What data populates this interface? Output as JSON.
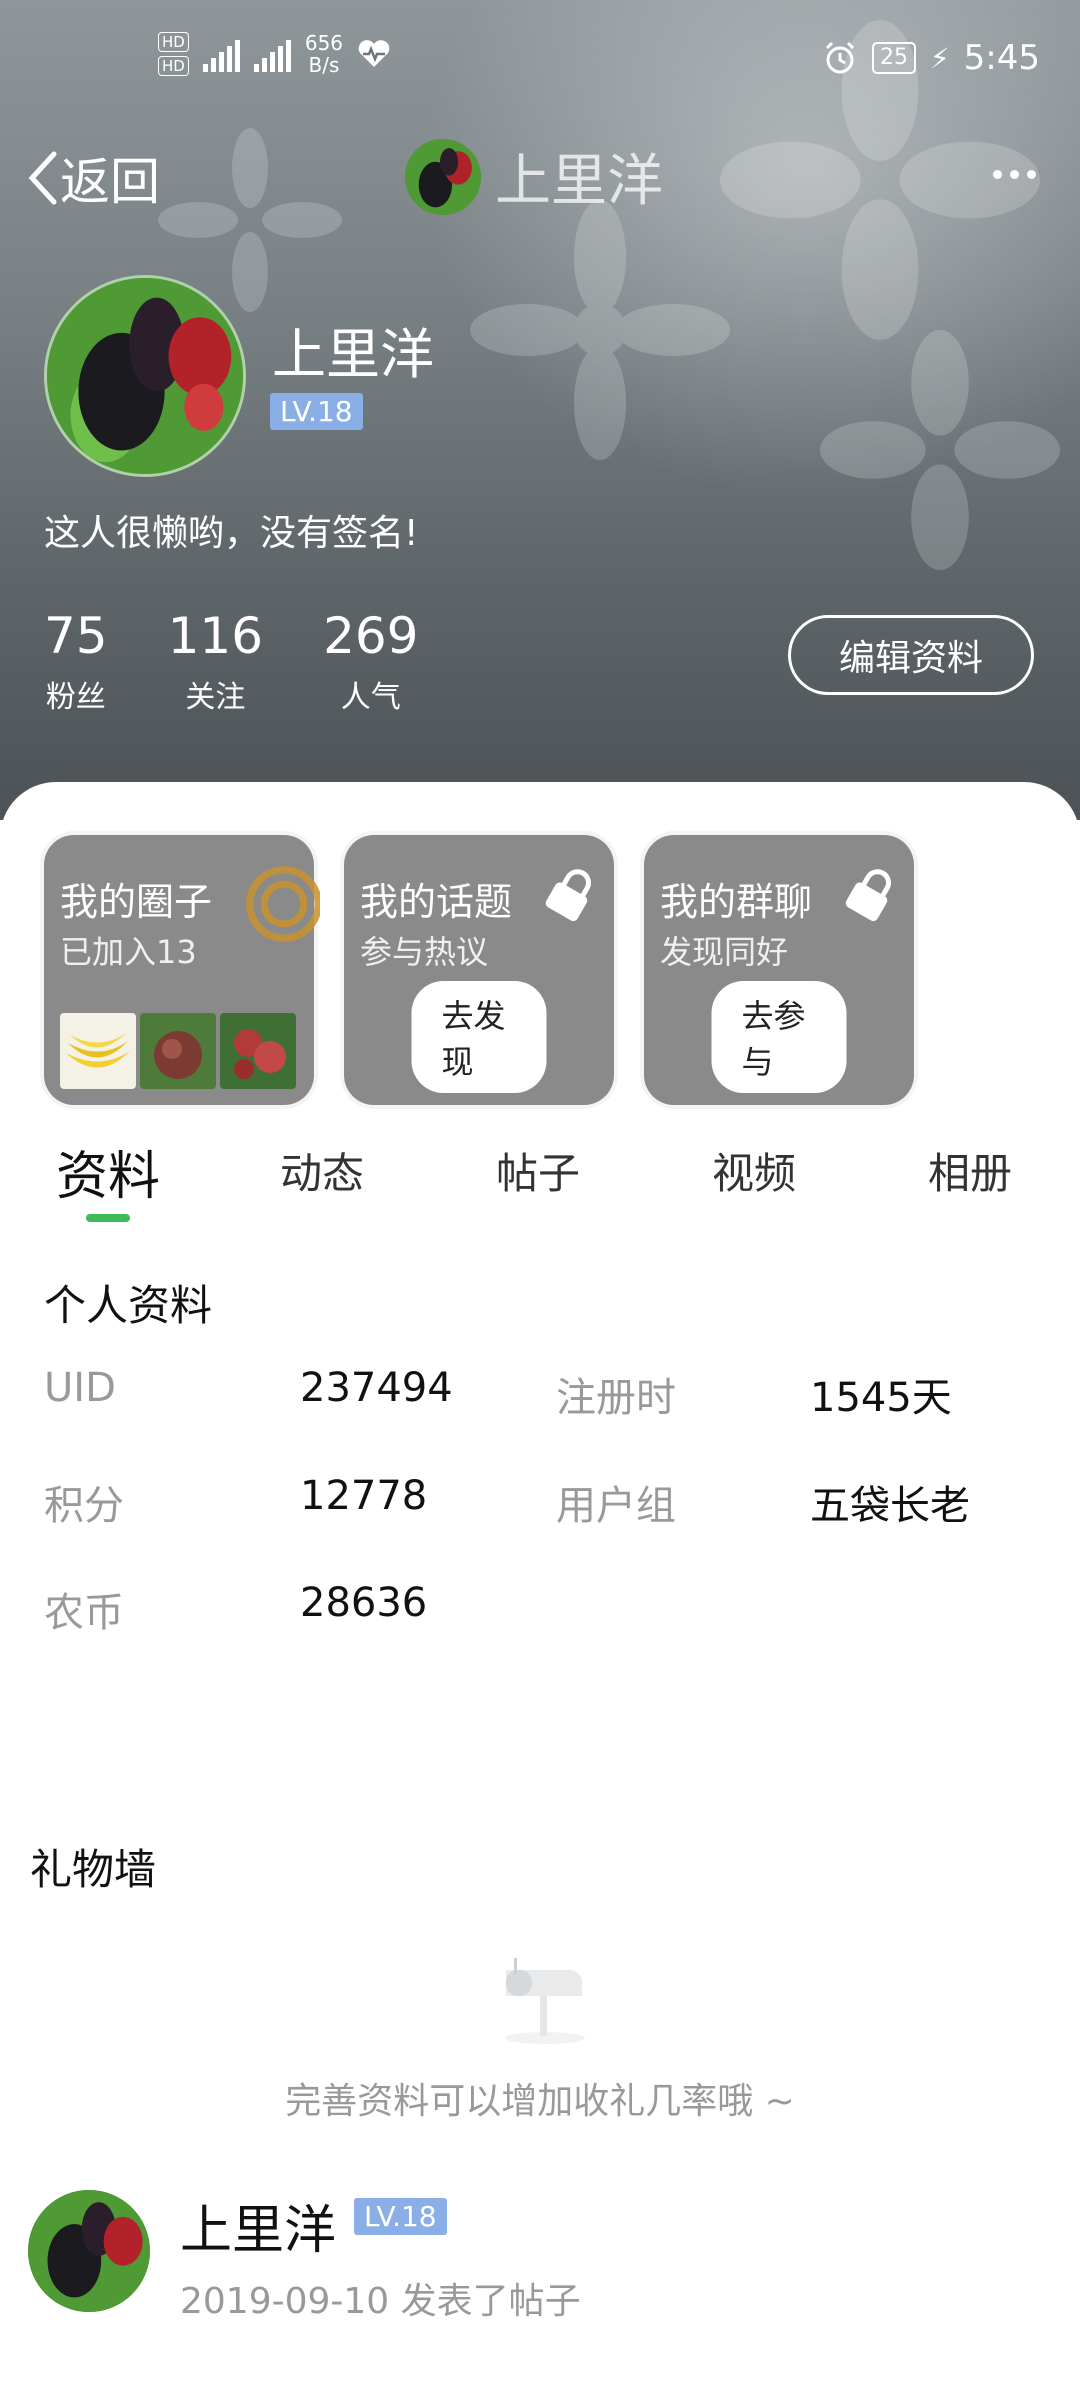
{
  "status_bar": {
    "hd1": "HD",
    "hd2": "HD",
    "net_speed_value": "656",
    "net_speed_unit": "B/s",
    "battery": "25",
    "time": "5:45"
  },
  "nav": {
    "back_label": "返回",
    "title": "上里洋"
  },
  "profile": {
    "username": "上里洋",
    "level": "LV.18",
    "bio": "这人很懒哟，没有签名!",
    "stats": [
      {
        "value": "75",
        "label": "粉丝"
      },
      {
        "value": "116",
        "label": "关注"
      },
      {
        "value": "269",
        "label": "人气"
      }
    ],
    "edit_label": "编辑资料"
  },
  "cards": [
    {
      "title": "我的圈子",
      "subtitle": "已加入13"
    },
    {
      "title": "我的话题",
      "subtitle": "参与热议",
      "button": "去发现"
    },
    {
      "title": "我的群聊",
      "subtitle": "发现同好",
      "button": "去参与"
    }
  ],
  "tabs": [
    {
      "label": "资料",
      "active": true
    },
    {
      "label": "动态"
    },
    {
      "label": "帖子"
    },
    {
      "label": "视频"
    },
    {
      "label": "相册"
    }
  ],
  "personal_info": {
    "title": "个人资料",
    "rows": [
      {
        "k1": "UID",
        "v1": "237494",
        "k2": "注册时",
        "v2": "1545天"
      },
      {
        "k1": "积分",
        "v1": "12778",
        "k2": "用户组",
        "v2": "五袋长老"
      },
      {
        "k1": "农币",
        "v1": "28636"
      }
    ]
  },
  "gift_wall": {
    "title": "礼物墙",
    "empty_hint": "完善资料可以增加收礼几率哦 ~"
  },
  "feed": {
    "name": "上里洋",
    "level": "LV.18",
    "meta": "2019-09-10 发表了帖子"
  },
  "colors": {
    "accent_green": "#3dbb59",
    "level_badge": "#8aaee6",
    "card_gray": "#8a8a8a"
  }
}
